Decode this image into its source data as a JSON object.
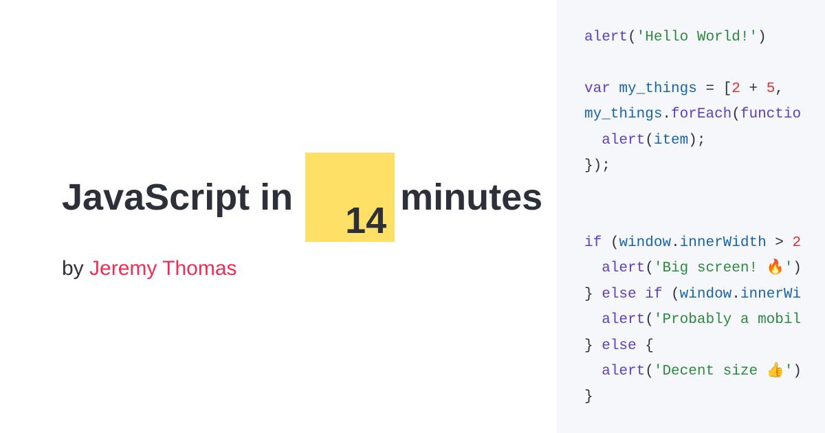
{
  "title": {
    "pre": "JavaScript in",
    "number": "14",
    "post": "minutes"
  },
  "byline": {
    "by": "by ",
    "author": "Jeremy Thomas"
  },
  "code": {
    "l1": {
      "fn": "alert",
      "p1": "(",
      "str": "'Hello World!'",
      "p2": ")"
    },
    "l2": {
      "kw": "var",
      "sp": " ",
      "var": "my_things",
      "eq": " = [",
      "n1": "2",
      "plus": " + ",
      "n2": "5",
      "comma": ","
    },
    "l3": {
      "var": "my_things",
      "dot": ".",
      "fn": "forEach",
      "p1": "(",
      "kw": "functio"
    },
    "l4": {
      "indent": "  ",
      "fn": "alert",
      "p1": "(",
      "var": "item",
      "p2": ");"
    },
    "l5": {
      "p": "});"
    },
    "l6": {
      "kw": "if",
      "sp": " (",
      "obj": "window",
      "dot": ".",
      "prop": "innerWidth",
      "gt": " > ",
      "num": "2"
    },
    "l7": {
      "indent": "  ",
      "fn": "alert",
      "p1": "(",
      "str": "'Big screen! 🔥'",
      "p2": ")"
    },
    "l8": {
      "p1": "} ",
      "kw": "else if",
      "p2": " (",
      "obj": "window",
      "dot": ".",
      "prop": "innerWi"
    },
    "l9": {
      "indent": "  ",
      "fn": "alert",
      "p1": "(",
      "str": "'Probably a mobil"
    },
    "l10": {
      "p1": "} ",
      "kw": "else",
      "p2": " {"
    },
    "l11": {
      "indent": "  ",
      "fn": "alert",
      "p1": "(",
      "str": "'Decent size 👍'",
      "p2": ")"
    },
    "l12": {
      "p": "}"
    }
  }
}
